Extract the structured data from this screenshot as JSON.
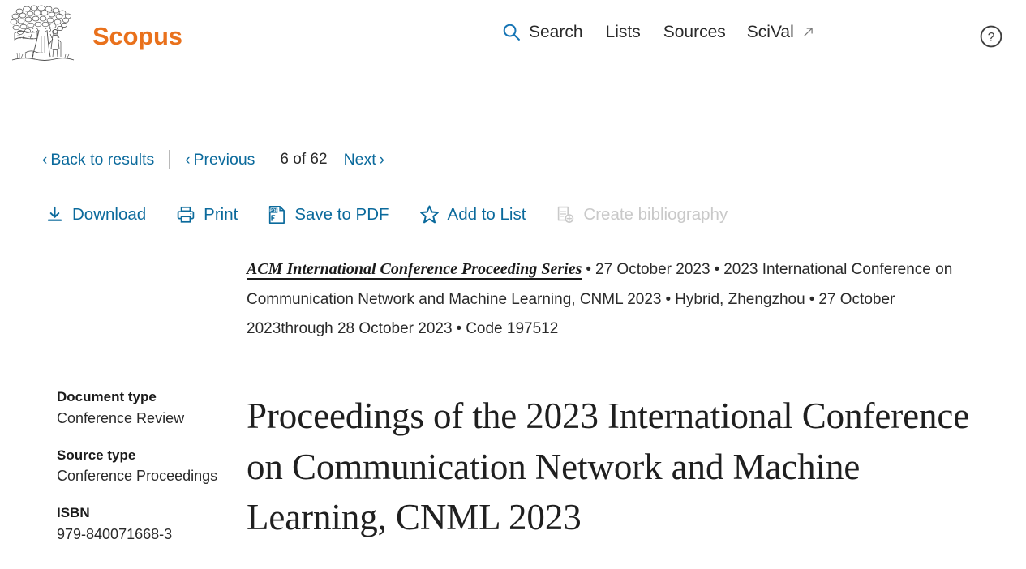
{
  "header": {
    "brand_name": "Scopus",
    "logo_icon": "elsevier-tree-logo",
    "nav": [
      {
        "label": "Search",
        "icon": "search-icon"
      },
      {
        "label": "Lists",
        "icon": null
      },
      {
        "label": "Sources",
        "icon": null
      },
      {
        "label": "SciVal",
        "icon": "external-link-icon"
      }
    ],
    "help_icon": "question-circle-icon"
  },
  "results_nav": {
    "back_label": "Back to results",
    "previous_label": "Previous",
    "current_index": "6",
    "of_label": "of",
    "total": "62",
    "next_label": "Next"
  },
  "toolbar": {
    "actions": [
      {
        "label": "Download",
        "icon": "download-icon",
        "disabled": false
      },
      {
        "label": "Print",
        "icon": "printer-icon",
        "disabled": false
      },
      {
        "label": "Save to PDF",
        "icon": "pdf-icon",
        "disabled": false
      },
      {
        "label": "Add to List",
        "icon": "star-icon",
        "disabled": false
      },
      {
        "label": "Create bibliography",
        "icon": "create-bibliography-icon",
        "disabled": true
      }
    ]
  },
  "sidebar": {
    "fields": [
      {
        "label": "Document type",
        "value": "Conference Review"
      },
      {
        "label": "Source type",
        "value": "Conference Proceedings"
      },
      {
        "label": "ISBN",
        "value": "979-840071668-3"
      }
    ]
  },
  "document": {
    "source_title": "ACM International Conference Proceeding Series",
    "publication_date": "27 October 2023",
    "conference_name": "2023 International Conference on Communication Network and Machine Learning, CNML 2023",
    "location": "Hybrid, Zhengzhou",
    "conference_dates": "27 October 2023through 28 October 2023",
    "code": "Code 197512",
    "separator": "•",
    "title": "Proceedings of the 2023 International Conference on Communication Network and Machine Learning, CNML 2023"
  },
  "colors": {
    "brand_orange": "#e9711c",
    "link_blue": "#0b6a9c",
    "search_icon_blue": "#1675b5",
    "text_dark": "#2a2a2a",
    "disabled_grey": "#c9c9c9"
  }
}
